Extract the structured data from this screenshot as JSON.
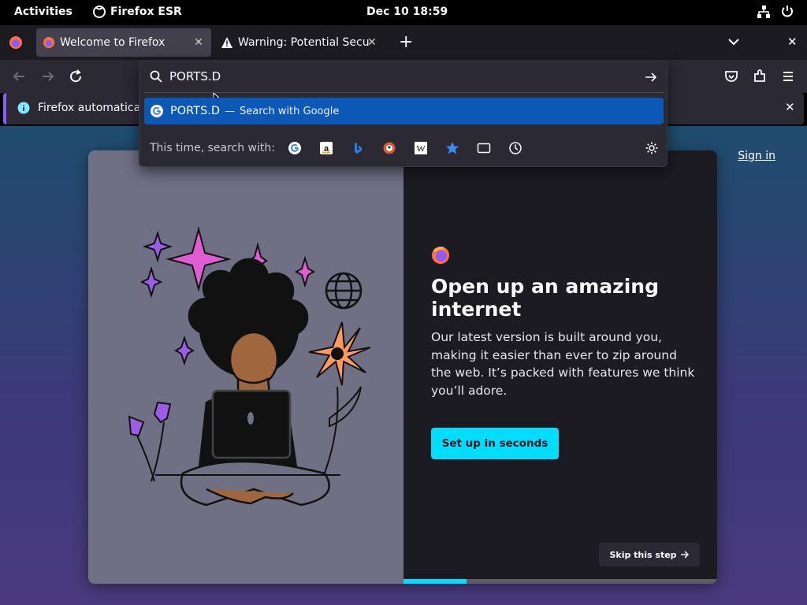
{
  "topbar": {
    "activities": "Activities",
    "app_name": "Firefox ESR",
    "clock": "Dec 10  18:59"
  },
  "tabs": [
    {
      "title": "Welcome to Firefox",
      "active": true
    },
    {
      "title": "Warning: Potential Securi",
      "active": false
    }
  ],
  "urlbar": {
    "value": "PORTS.D",
    "result_text": "PORTS.D",
    "result_sep": "—",
    "result_action": "Search with Google",
    "search_with_label": "This time, search with:"
  },
  "notification": {
    "text": "Firefox automatically"
  },
  "page": {
    "sign_in": "Sign in",
    "headline": "Open up an amazing internet",
    "body": "Our latest version is built around you, making it easier than ever to zip around the web. It’s packed with features we think you’ll adore.",
    "primary_button": "Set up in seconds",
    "skip_button": "Skip this step",
    "progress_fraction": 0.2
  },
  "colors": {
    "accent": "#00ddff",
    "selection": "#0c58b6",
    "toolbar": "#2b2a33",
    "tabbar": "#1c1b22"
  }
}
